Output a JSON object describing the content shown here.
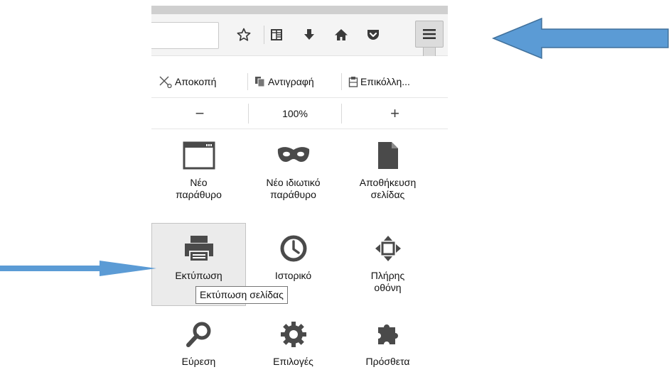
{
  "toolbar": {
    "icons": [
      "bookmark-star-icon",
      "reading-list-icon",
      "download-icon",
      "home-icon",
      "pocket-icon",
      "hamburger-menu-icon"
    ]
  },
  "edit": {
    "cut": "Αποκοπή",
    "copy": "Αντιγραφή",
    "paste": "Επικόλλη..."
  },
  "zoom": {
    "minus": "−",
    "value": "100%",
    "plus": "+"
  },
  "tiles": [
    {
      "line1": "Νέο",
      "line2": "παράθυρο",
      "icon": "new-window-icon"
    },
    {
      "line1": "Νέο ιδιωτικό",
      "line2": "παράθυρο",
      "icon": "private-mask-icon"
    },
    {
      "line1": "Αποθήκευση",
      "line2": "σελίδας",
      "icon": "save-page-icon"
    },
    {
      "line1": "Εκτύπωση",
      "line2": "",
      "icon": "print-icon"
    },
    {
      "line1": "Ιστορικό",
      "line2": "",
      "icon": "history-clock-icon"
    },
    {
      "line1": "Πλήρης",
      "line2": "οθόνη",
      "icon": "fullscreen-icon"
    },
    {
      "line1": "Εύρεση",
      "line2": "",
      "icon": "find-magnifier-icon"
    },
    {
      "line1": "Επιλογές",
      "line2": "",
      "icon": "options-gear-icon"
    },
    {
      "line1": "Πρόσθετα",
      "line2": "",
      "icon": "addons-puzzle-icon"
    }
  ],
  "tooltip": "Εκτύπωση σελίδας",
  "colors": {
    "icon": "#4a4a4a",
    "arrow": "#5b9bd5",
    "arrow_stroke": "#41719c",
    "hover_tile": "#ebebeb"
  }
}
